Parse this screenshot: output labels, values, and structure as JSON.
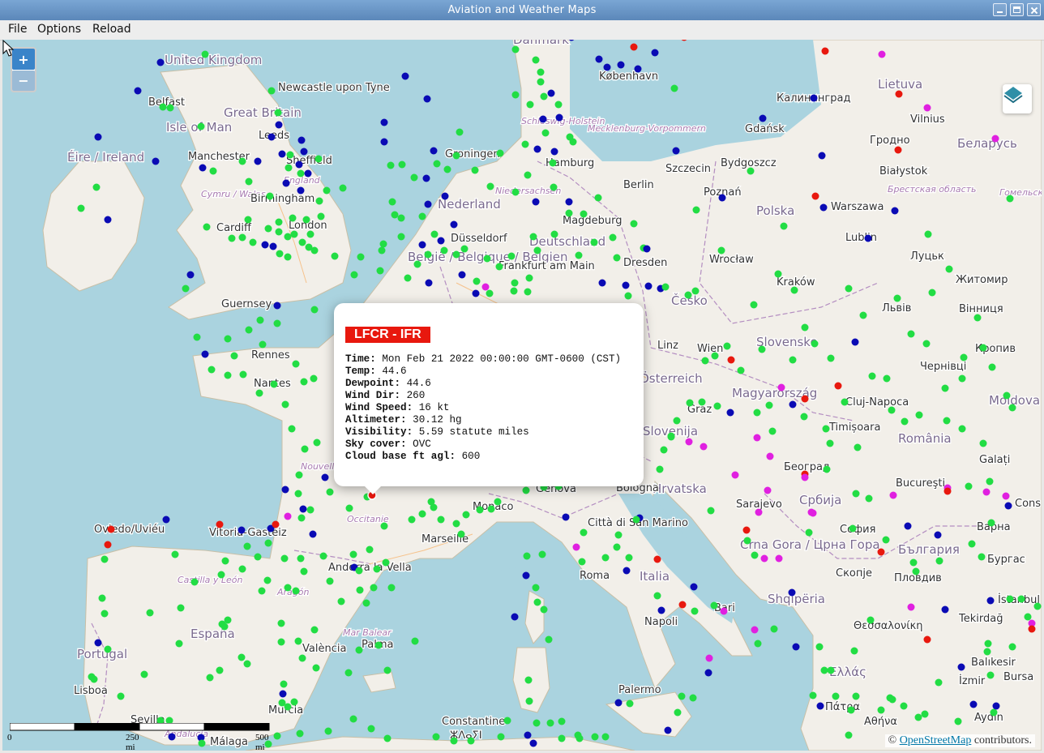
{
  "window": {
    "title": "Aviation and Weather Maps"
  },
  "menu": {
    "file": "File",
    "options": "Options",
    "reload": "Reload"
  },
  "zoom": {
    "in": "+",
    "out": "−"
  },
  "colors": {
    "vfr": "#22dd44",
    "mvfr": "#0a0ab4",
    "ifr": "#e8180e",
    "lifr": "#e020e0",
    "land": "#f2efe9",
    "sea": "#aad3df"
  },
  "popup": {
    "station": "LFCR - IFR",
    "rows": [
      {
        "label": "Time:",
        "value": "Mon Feb 21 2022 00:00:00 GMT-0600 (CST)"
      },
      {
        "label": "Temp:",
        "value": "44.6"
      },
      {
        "label": "Dewpoint:",
        "value": "44.6"
      },
      {
        "label": "Wind Dir:",
        "value": "260"
      },
      {
        "label": "Wind Speed:",
        "value": "16 kt"
      },
      {
        "label": "Altimeter:",
        "value": "30.12 hg"
      },
      {
        "label": "Visibility:",
        "value": "5.59 statute miles"
      },
      {
        "label": "Sky cover:",
        "value": "OVC"
      },
      {
        "label": "Cloud base ft agl:",
        "value": "600"
      }
    ]
  },
  "scale": {
    "zero": "0",
    "mid": "250 mi",
    "max": "500 mi"
  },
  "attribution": {
    "prefix": "©",
    "link": "OpenStreetMap",
    "suffix": "contributors."
  },
  "map_labels": [
    "Danmark",
    "United Kingdom",
    "Newcastle upon Tyne",
    "Belfast",
    "Great Britain",
    "Isle of Man",
    "Leeds",
    "Manchester",
    "Sheffield",
    "Éire / Ireland",
    "England",
    "Cymru / Wales",
    "Birmingham",
    "Cardiff",
    "London",
    "København",
    "Schleswig-Holstein",
    "Mecklenburg-Vorpommern",
    "Калининград",
    "Lietuva",
    "Vilnius",
    "Gdańsk",
    "Hamburg",
    "Szczecin",
    "Bydgoszcz",
    "Гродно",
    "Беларусь",
    "Groningen",
    "Niedersachsen",
    "Berlin",
    "Białystok",
    "Nederland",
    "Magdeburg",
    "Poznań",
    "Warszawa",
    "Брестская область",
    "Гомельская область",
    "Polska",
    "Düsseldorf",
    "Deutschland",
    "België / Belgique / Belgien",
    "Frankfurt am Main",
    "Dresden",
    "Wrocław",
    "Lublin",
    "Луцьк",
    "Житомир",
    "Kraków",
    "Česko",
    "Львів",
    "Вінниця",
    "Guernsey",
    "Rennes",
    "Nantes",
    "Linz",
    "Wien",
    "Slovensko",
    "Кропив",
    "Чернівці",
    "Österreich",
    "Magyarország",
    "Cluj-Napoca",
    "Moldova",
    "Graz",
    "Slovenija",
    "Timișoara",
    "România",
    "Galați",
    "Nouvelle-Aquitaine",
    "Hrvatska",
    "Београд",
    "Србија",
    "Bucureşti",
    "Cons",
    "Genova",
    "Bologna",
    "Monaco",
    "Occitanie",
    "Città di San Marino",
    "Sarajevo",
    "Oviedo/Uviéu",
    "Vitoria-Gasteiz",
    "Marseille",
    "Crna Gora / Црна Гора",
    "София",
    "България",
    "Варна",
    "Бургас",
    "Andorra la Vella",
    "Roma",
    "Italia",
    "Скопје",
    "Пловдив",
    "Castilla y León",
    "Aragón",
    "Shqipëria",
    "İstanbul",
    "España",
    "Mar Balear",
    "Bari",
    "Napoli",
    "Θεσσαλονίκη",
    "Tekirdağ",
    "València",
    "Palma",
    "Portugal",
    "Balıkesir",
    "Bursa",
    "Lisboa",
    "Ελλάς",
    "Πάτρα",
    "İzmir",
    "Palermo",
    "Murcia",
    "Constantine",
    "ⵣⴷⴰⵢⵏ",
    "Sevilla",
    "Andalucía",
    "Málaga",
    "Αθήνα",
    "Aydın"
  ]
}
